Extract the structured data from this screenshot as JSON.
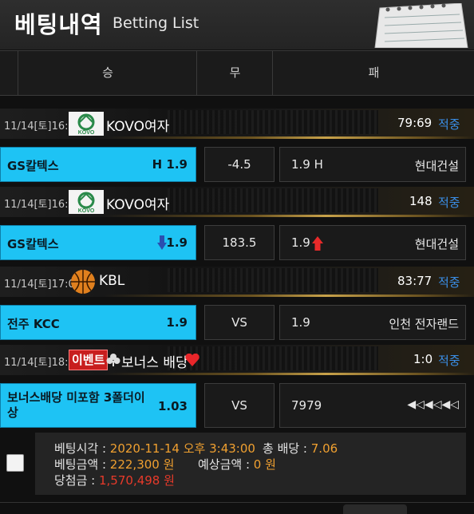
{
  "header": {
    "title": "베팅내역",
    "subtitle": "Betting List"
  },
  "columns": {
    "win": "승",
    "draw": "무",
    "lose": "패"
  },
  "matches": [
    {
      "time": "11/14[토]16:00",
      "league": "KOVO여자",
      "logo": "kovo-logo",
      "score": "79:69",
      "status": "적중",
      "home": {
        "team": "GS칼텍스",
        "odd": "H 1.9"
      },
      "draw": "-4.5",
      "away": {
        "odd": "1.9 H",
        "team": "현대건설"
      }
    },
    {
      "time": "11/14[토]16:00",
      "league": "KOVO여자",
      "logo": "kovo-logo",
      "score": "148",
      "status": "적중",
      "home": {
        "team": "GS칼텍스",
        "odd": "1.9",
        "icon": "under-arrow-icon"
      },
      "draw": "183.5",
      "away": {
        "odd": "1.9",
        "icon": "over-arrow-icon",
        "team": "현대건설"
      }
    },
    {
      "time": "11/14[토]17:00",
      "league": "KBL",
      "logo": "basketball-icon",
      "score": "83:77",
      "status": "적중",
      "home": {
        "team": "전주 KCC",
        "odd": "1.9"
      },
      "draw": "VS",
      "away": {
        "odd": "1.9",
        "team": "인천 전자랜드"
      }
    },
    {
      "time": "11/14[토]18:00",
      "league": "보너스 배당",
      "badge": "이벤트",
      "logo": "club-icon",
      "score": "1:0",
      "status": "적중",
      "home": {
        "team": "보너스배당 미포함 3폴더이상",
        "odd": "1.03"
      },
      "draw": "VS",
      "away": {
        "odd": "7979",
        "team": "◀◁◀◁◀◁"
      }
    }
  ],
  "summary": {
    "bet_time_label": "베팅시각 : ",
    "bet_time": "2020-11-14 오후 3:43:00",
    "total_odds_label": "총 배당 : ",
    "total_odds": "7.06",
    "bet_amount_label": "베팅금액 : ",
    "bet_amount": "222,300 원",
    "expected_label": "예상금액 : ",
    "expected": "0 원",
    "win_amount_label": "당첨금 : ",
    "win_amount": "1,570,498 원"
  },
  "colors": {
    "accent": "#1ec3f4",
    "status": "#3a8ee6",
    "highlight": "#f0a030",
    "win": "#e83a2a"
  }
}
